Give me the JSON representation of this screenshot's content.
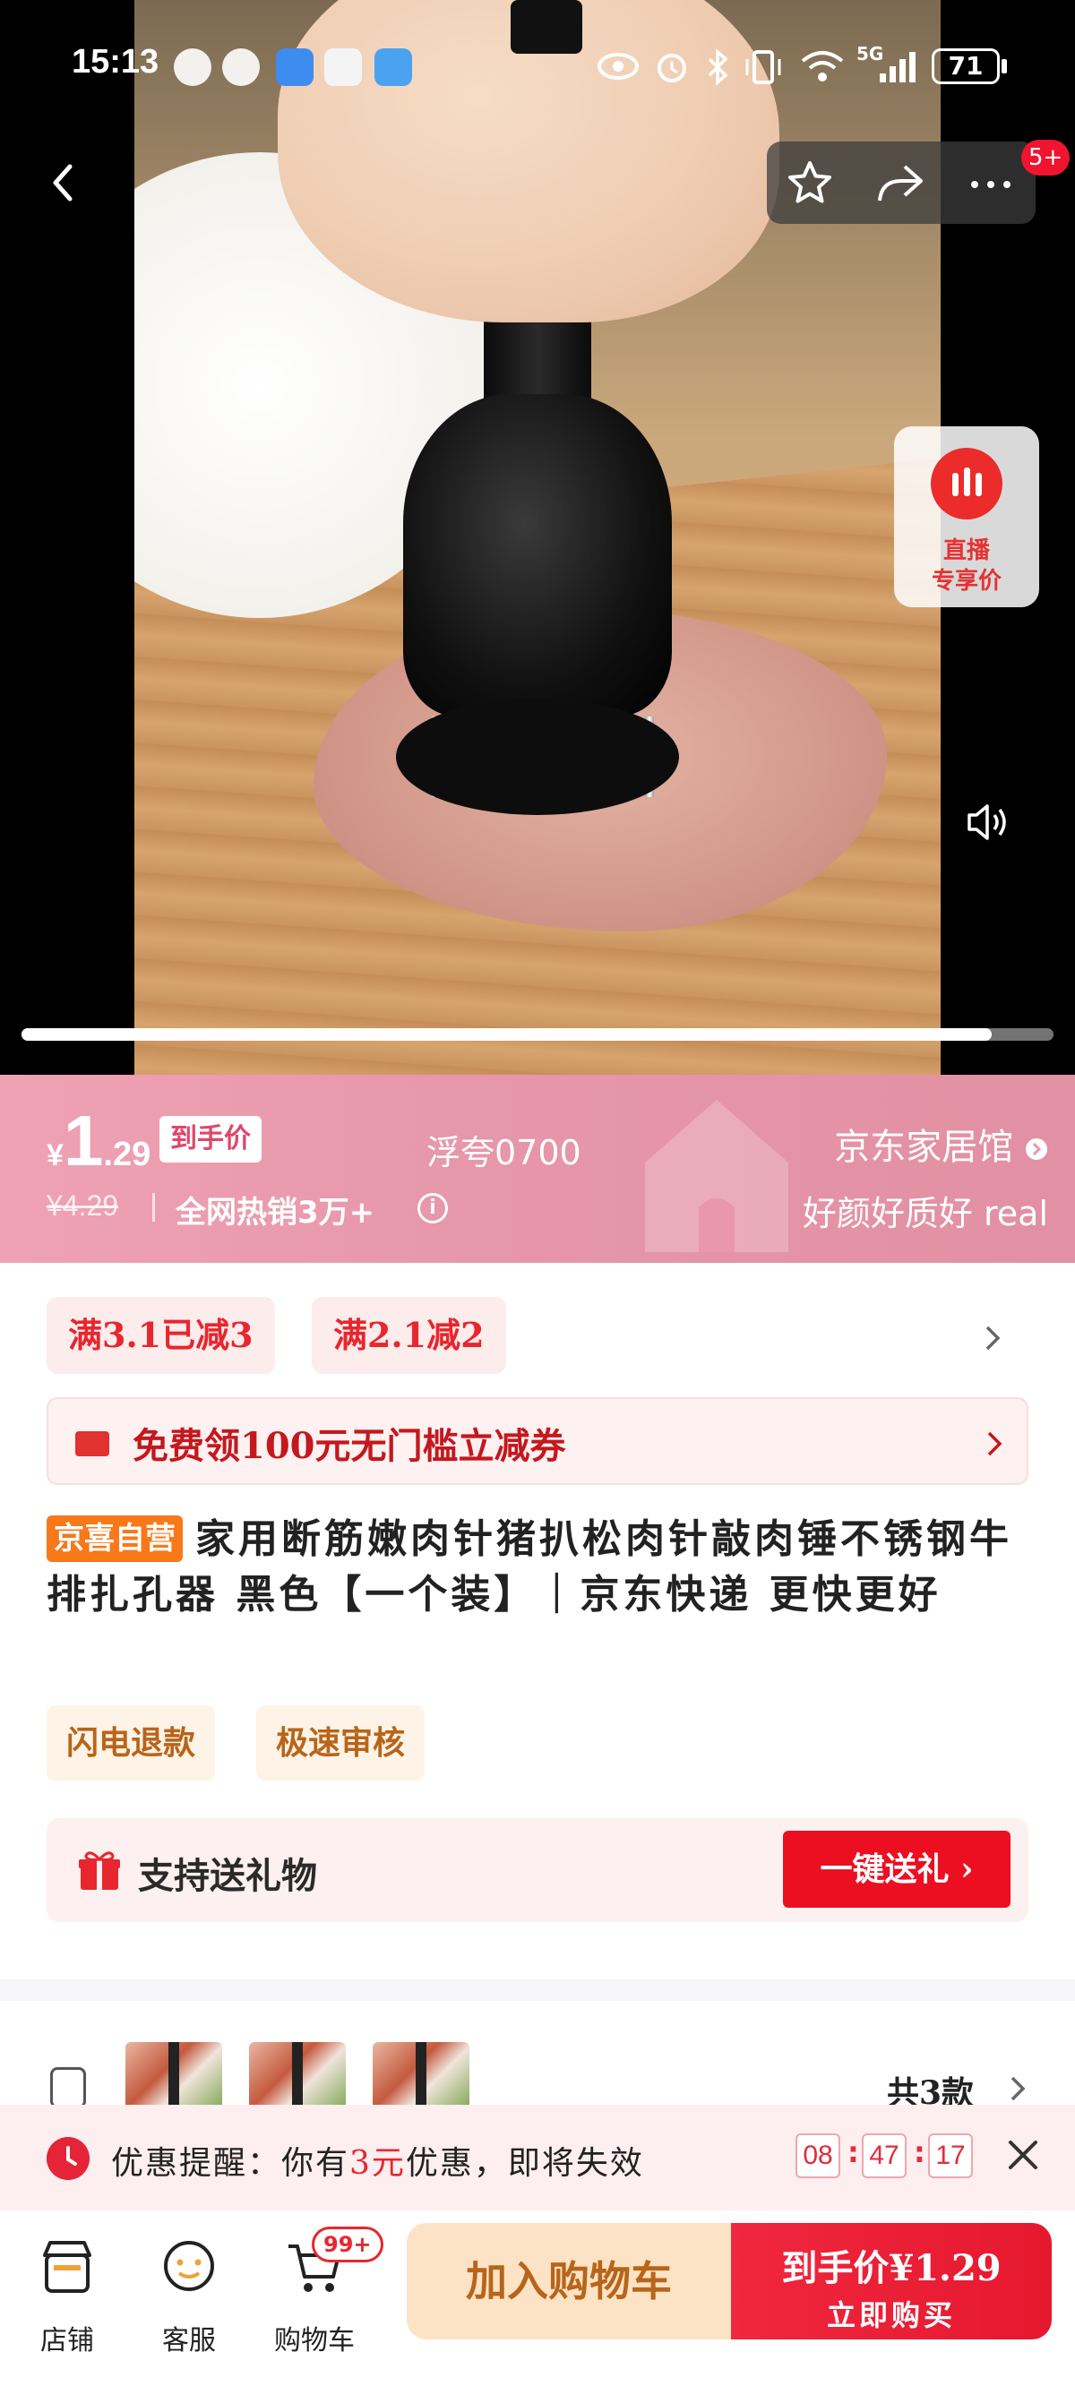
{
  "status_bar": {
    "time": "15:13",
    "battery": "71",
    "network": "5G"
  },
  "top_bar": {
    "more_badge": "5+"
  },
  "live": {
    "line1": "直播",
    "line2": "专享价"
  },
  "video": {
    "progress_fraction": 0.94
  },
  "price": {
    "symbol": "¥",
    "integer": "1",
    "decimal": ".29",
    "tag": "到手价",
    "original": "¥4.29",
    "sales": "全网热销3万+",
    "live_code": "浮夸0700"
  },
  "store": {
    "name": "京东家居馆",
    "slogan": "好颜好质好 real"
  },
  "promotions": {
    "chips": [
      "满3.1已减3",
      "满2.1减2"
    ]
  },
  "coupon": {
    "text": "免费领100元无门槛立减券"
  },
  "product": {
    "self_tag": "京喜自营",
    "title": "家用断筋嫩肉针猪扒松肉针敲肉锤不锈钢牛排扎孔器 黑色【一个装】｜京东快递 更快更好"
  },
  "services": [
    "闪电退款",
    "极速审核"
  ],
  "gift": {
    "text": "支持送礼物",
    "button": "一键送礼 ›"
  },
  "variants": {
    "count_label": "共3款"
  },
  "reminder": {
    "prefix": "优惠提醒：你有",
    "amount": "3元",
    "suffix": "优惠，即将失效",
    "hours": "08",
    "minutes": "47",
    "seconds": "17",
    "colon": ":"
  },
  "bottom_bar": {
    "shop_label": "店铺",
    "service_label": "客服",
    "cart_label": "购物车",
    "cart_badge": "99+",
    "add_cart": "加入购物车",
    "buy_top": "到手价¥1.29",
    "buy_bottom": "立即购买"
  },
  "colors": {
    "accent_red": "#e8262d",
    "banner_pink": "#e697a9",
    "self_tag_orange": "#f7791a",
    "service_brown": "#b8651a"
  }
}
